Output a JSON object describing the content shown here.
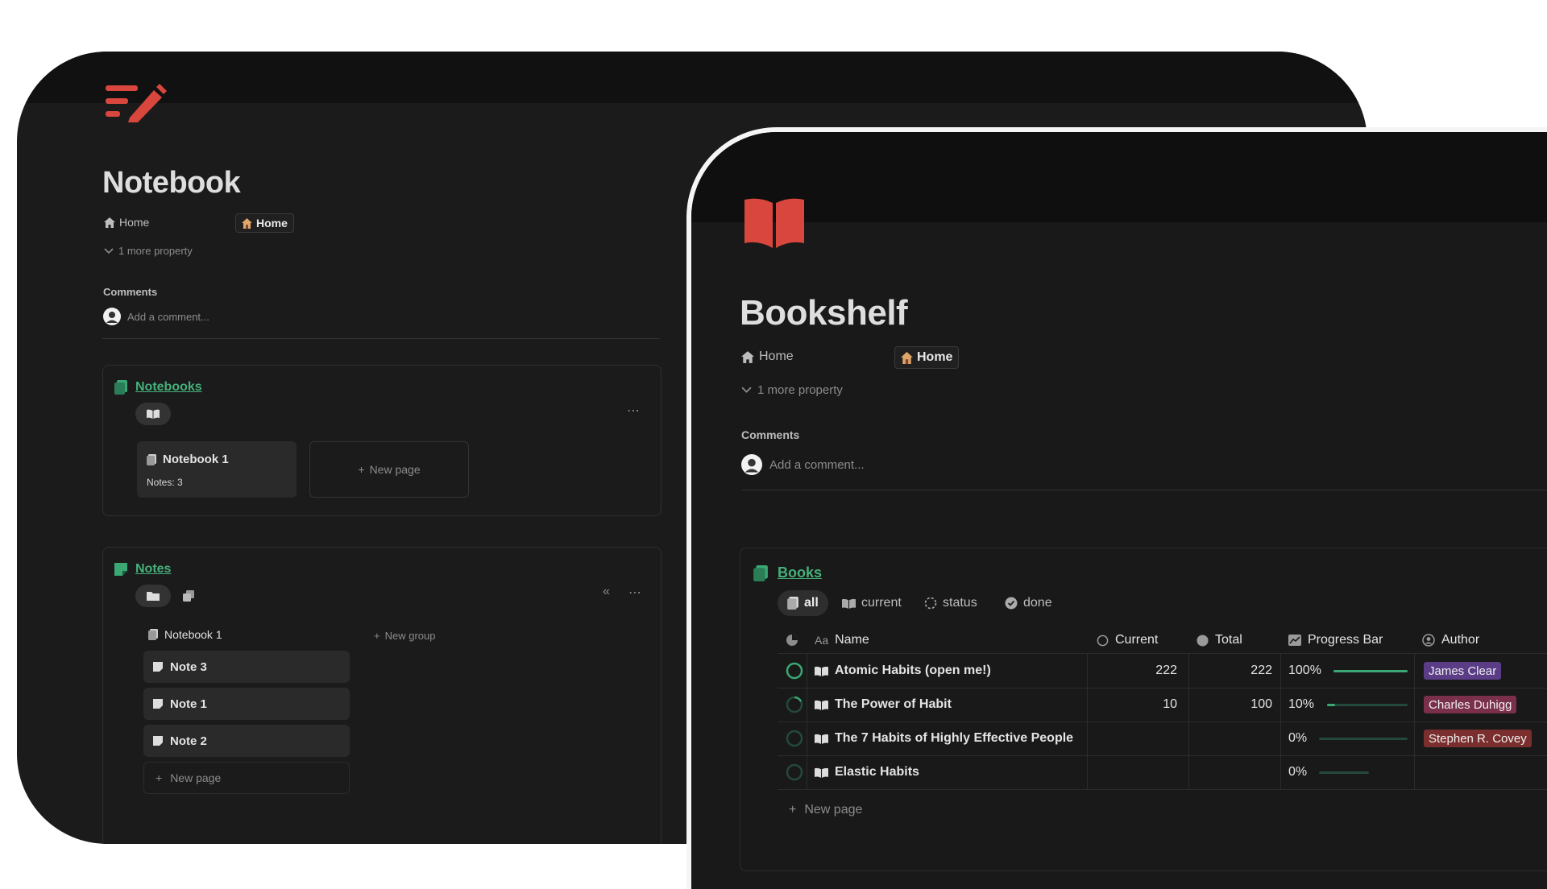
{
  "notebook": {
    "title": "Notebook",
    "property_label": "Home",
    "property_value": "Home",
    "more_property": "1 more property",
    "comments_label": "Comments",
    "comment_placeholder": "Add a comment...",
    "notebooks_db": {
      "title": "Notebooks",
      "cards": [
        {
          "title": "Notebook 1",
          "meta": "Notes: 3"
        }
      ],
      "new_page": "New page"
    },
    "notes_db": {
      "title": "Notes",
      "group_label": "Notebook 1",
      "items": [
        "Note 3",
        "Note 1",
        "Note 2"
      ],
      "new_page": "New page",
      "new_group": "New group"
    }
  },
  "bookshelf": {
    "title": "Bookshelf",
    "property_label": "Home",
    "property_value": "Home",
    "more_property": "1 more property",
    "comments_label": "Comments",
    "comment_placeholder": "Add a comment...",
    "books_db": {
      "title": "Books",
      "views": [
        "all",
        "current",
        "status",
        "done"
      ],
      "columns": {
        "name": "Name",
        "current": "Current",
        "total": "Total",
        "progress": "Progress Bar",
        "author": "Author"
      },
      "rows": [
        {
          "name": "Atomic Habits (open me!)",
          "current": "222",
          "total": "222",
          "progress_label": "100%",
          "progress": 1.0,
          "author": "James Clear",
          "author_color": "#5a3d86",
          "status": "done"
        },
        {
          "name": "The Power of Habit",
          "current": "10",
          "total": "100",
          "progress_label": "10%",
          "progress": 0.1,
          "author": "Charles Duhigg",
          "author_color": "#7a2f4a",
          "status": "partial"
        },
        {
          "name": "The 7 Habits of Highly Effective People",
          "current": "",
          "total": "",
          "progress_label": "0%",
          "progress": 0,
          "author": "Stephen R. Covey",
          "author_color": "#7a2e2e",
          "status": "empty"
        },
        {
          "name": "Elastic Habits",
          "current": "",
          "total": "",
          "progress_label": "0%",
          "progress": 0,
          "author": "",
          "author_color": "",
          "status": "empty"
        }
      ],
      "new_page": "New page"
    }
  },
  "colors": {
    "accent_red": "#d8463d",
    "accent_green": "#3aa774",
    "link_green": "#45b07a"
  }
}
